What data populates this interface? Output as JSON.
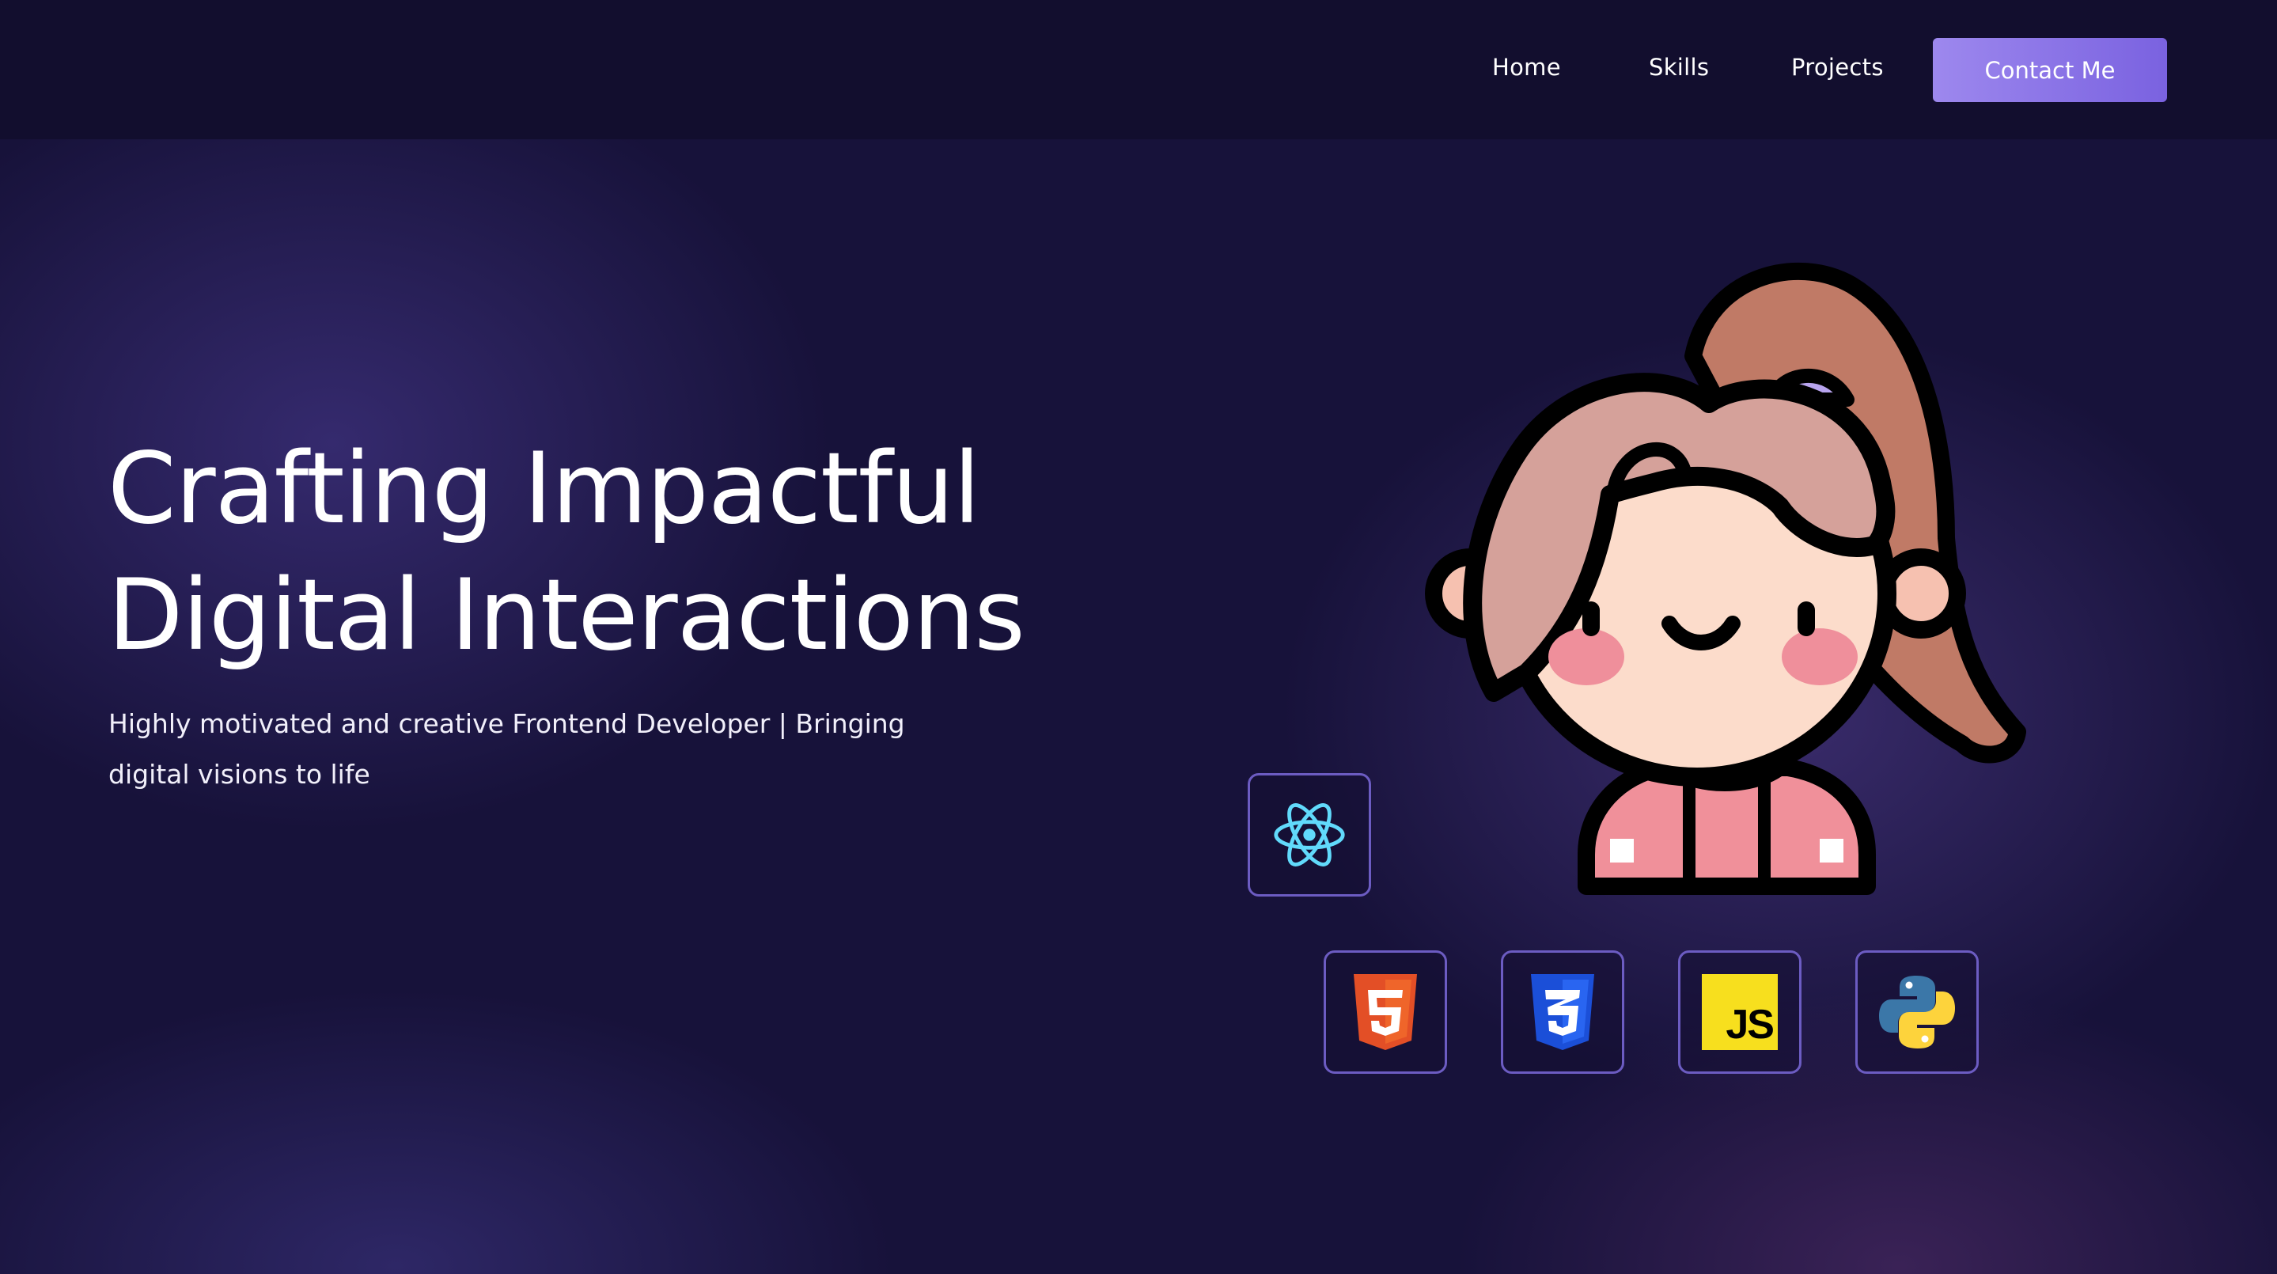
{
  "nav": {
    "links": [
      {
        "label": "Home"
      },
      {
        "label": "Skills"
      },
      {
        "label": "Projects"
      }
    ],
    "contact_label": "Contact Me"
  },
  "hero": {
    "title_line1": "Crafting Impactful",
    "title_line2": "Digital Interactions",
    "subtitle_line1": "Highly motivated and creative Frontend Developer | Bringing",
    "subtitle_line2": "digital visions to life"
  },
  "skills": {
    "tiles": [
      {
        "icon": "react-icon"
      },
      {
        "icon": "html5-icon"
      },
      {
        "icon": "css3-icon"
      },
      {
        "icon": "javascript-icon",
        "label": "JS"
      },
      {
        "icon": "python-icon"
      }
    ]
  },
  "colors": {
    "background": "#17123a",
    "navbar": "#120e2e",
    "accent": "#8b73e8",
    "tile_border": "#6c5cc2"
  }
}
